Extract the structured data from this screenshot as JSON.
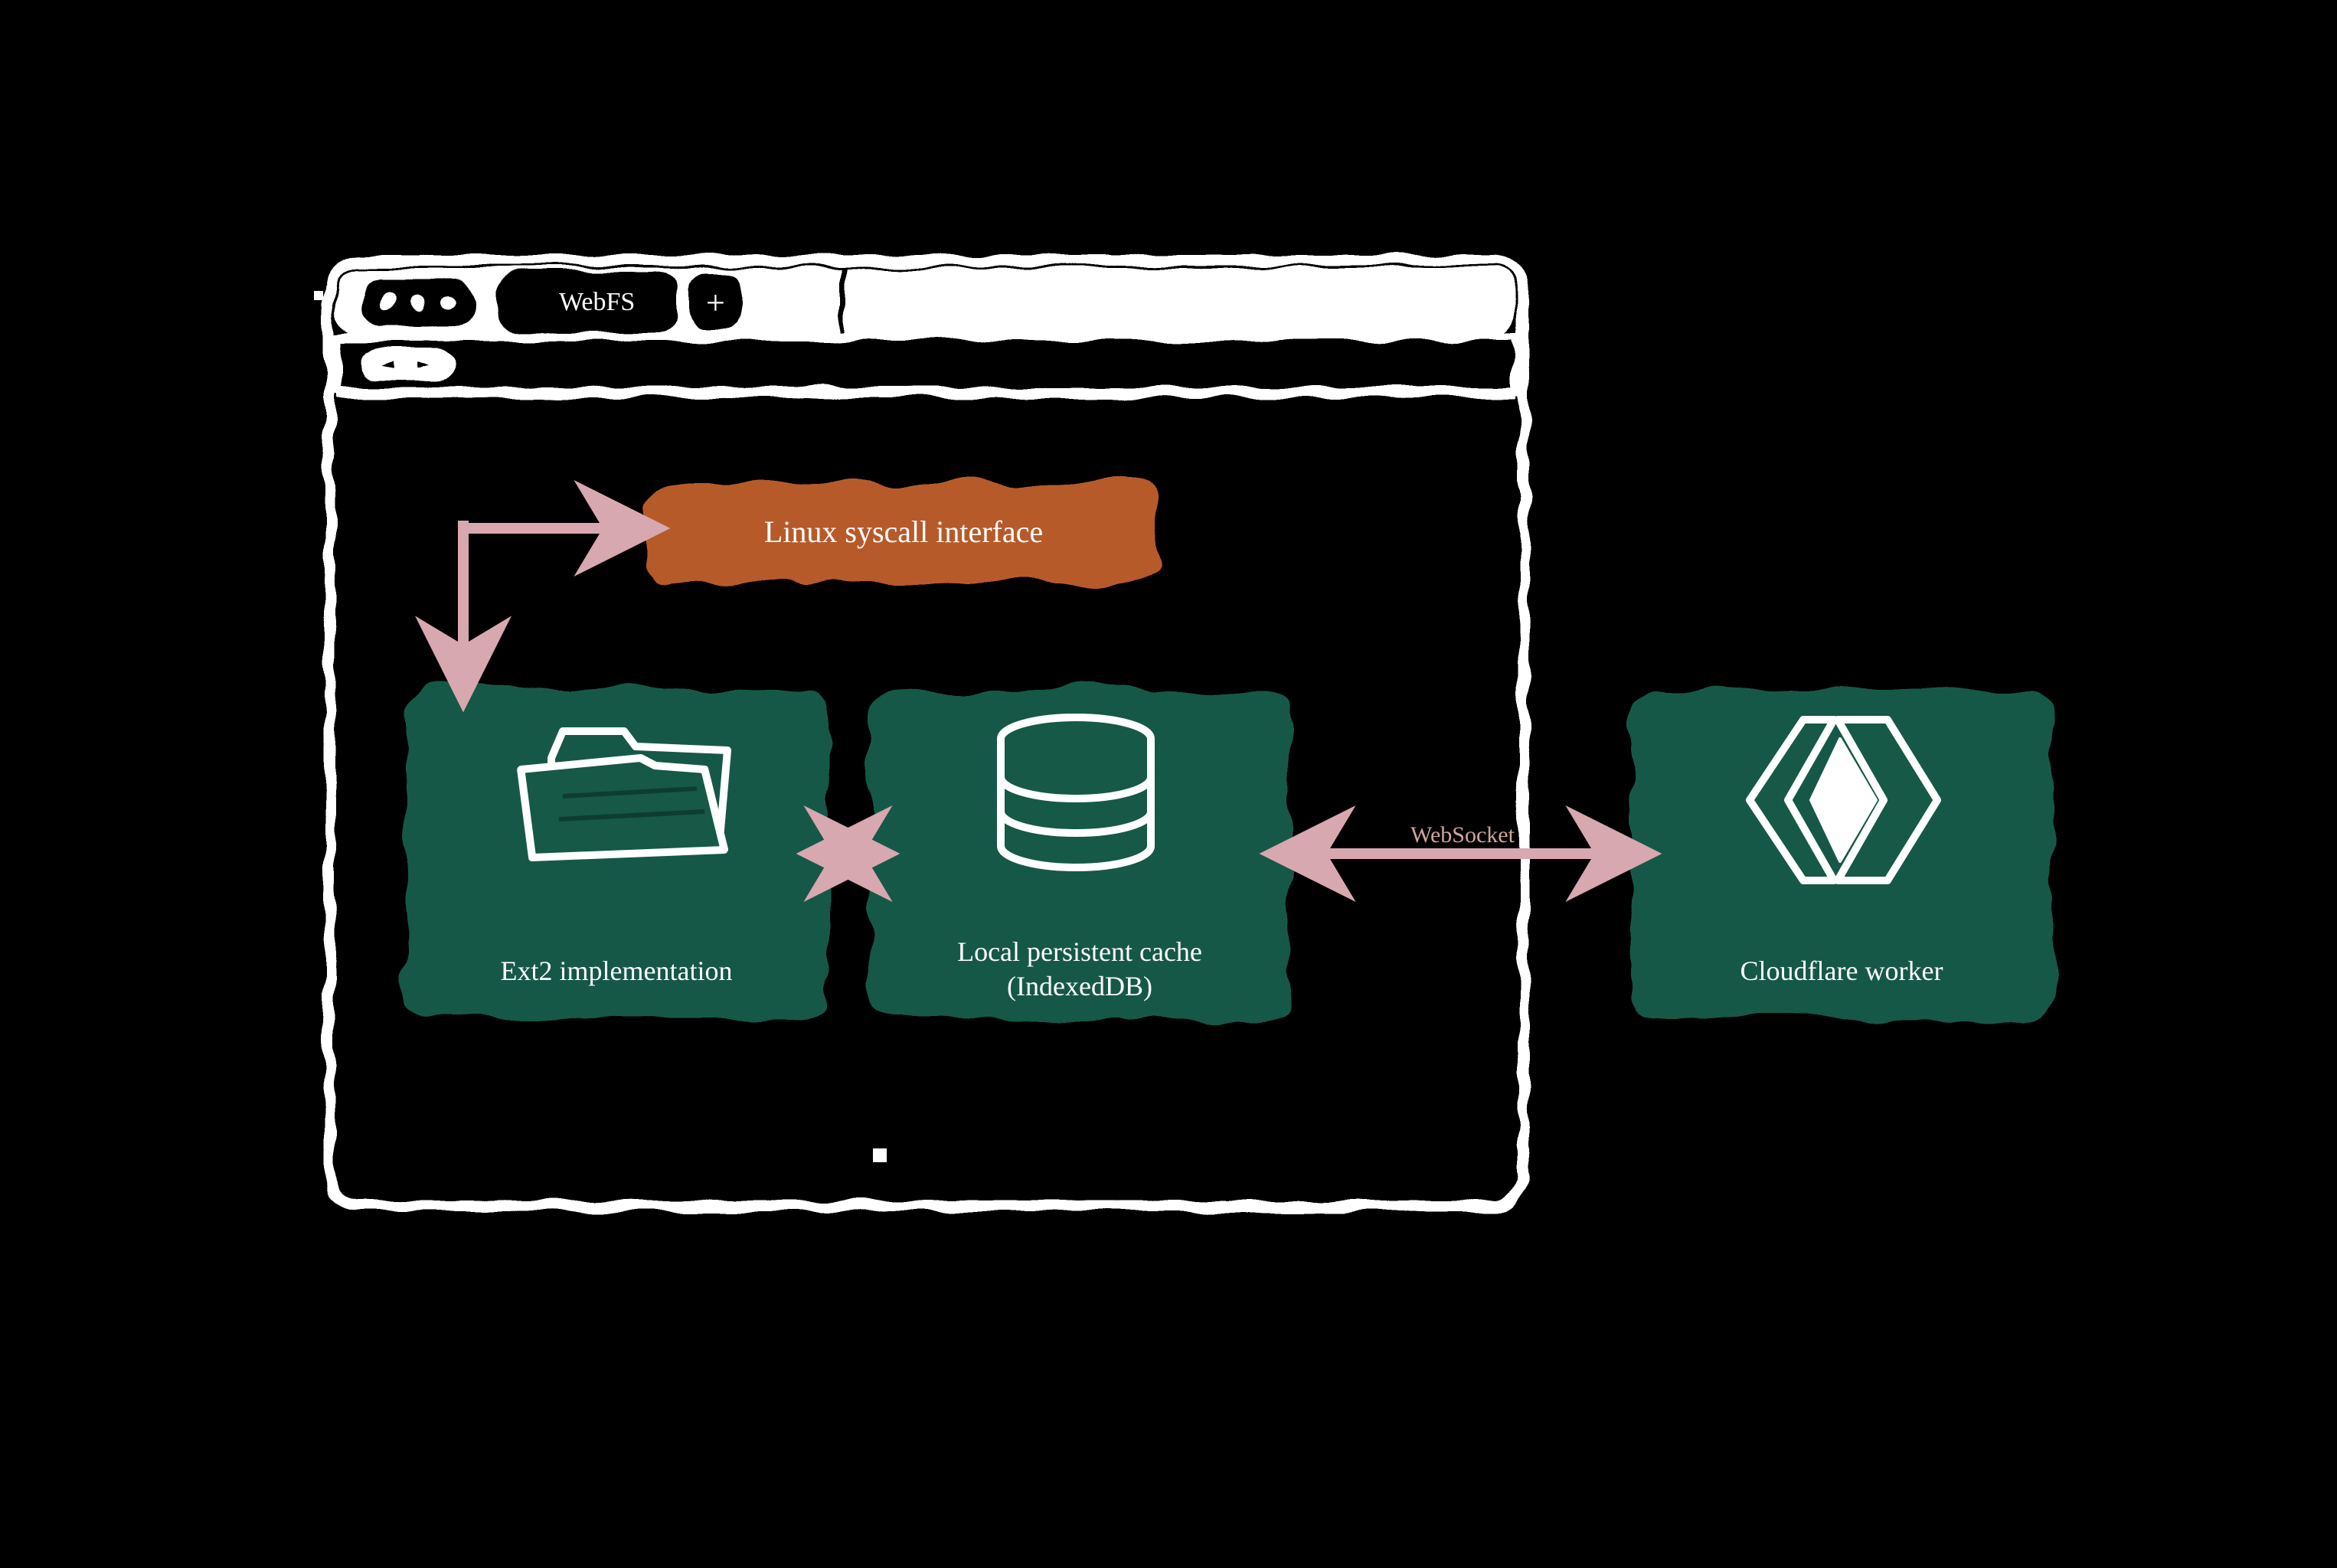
{
  "diagram": {
    "browser": {
      "tab_label": "WebFS",
      "plus_label": "+"
    },
    "nodes": {
      "syscall": {
        "label": "Linux syscall interface",
        "fill": "#b75a2a"
      },
      "ext2": {
        "label": "Ext2 implementation",
        "fill": "#155946"
      },
      "cache": {
        "label_line1": "Local persistent cache",
        "label_line2": "(IndexedDB)",
        "fill": "#155946"
      },
      "worker": {
        "label": "Cloudflare worker",
        "fill": "#155946"
      }
    },
    "edges": {
      "websocket": {
        "label": "WebSocket"
      }
    },
    "colors": {
      "arrow": "#d8a8b0",
      "white": "#ffffff",
      "black": "#000000",
      "green": "#155946",
      "orange": "#b75a2a"
    }
  }
}
